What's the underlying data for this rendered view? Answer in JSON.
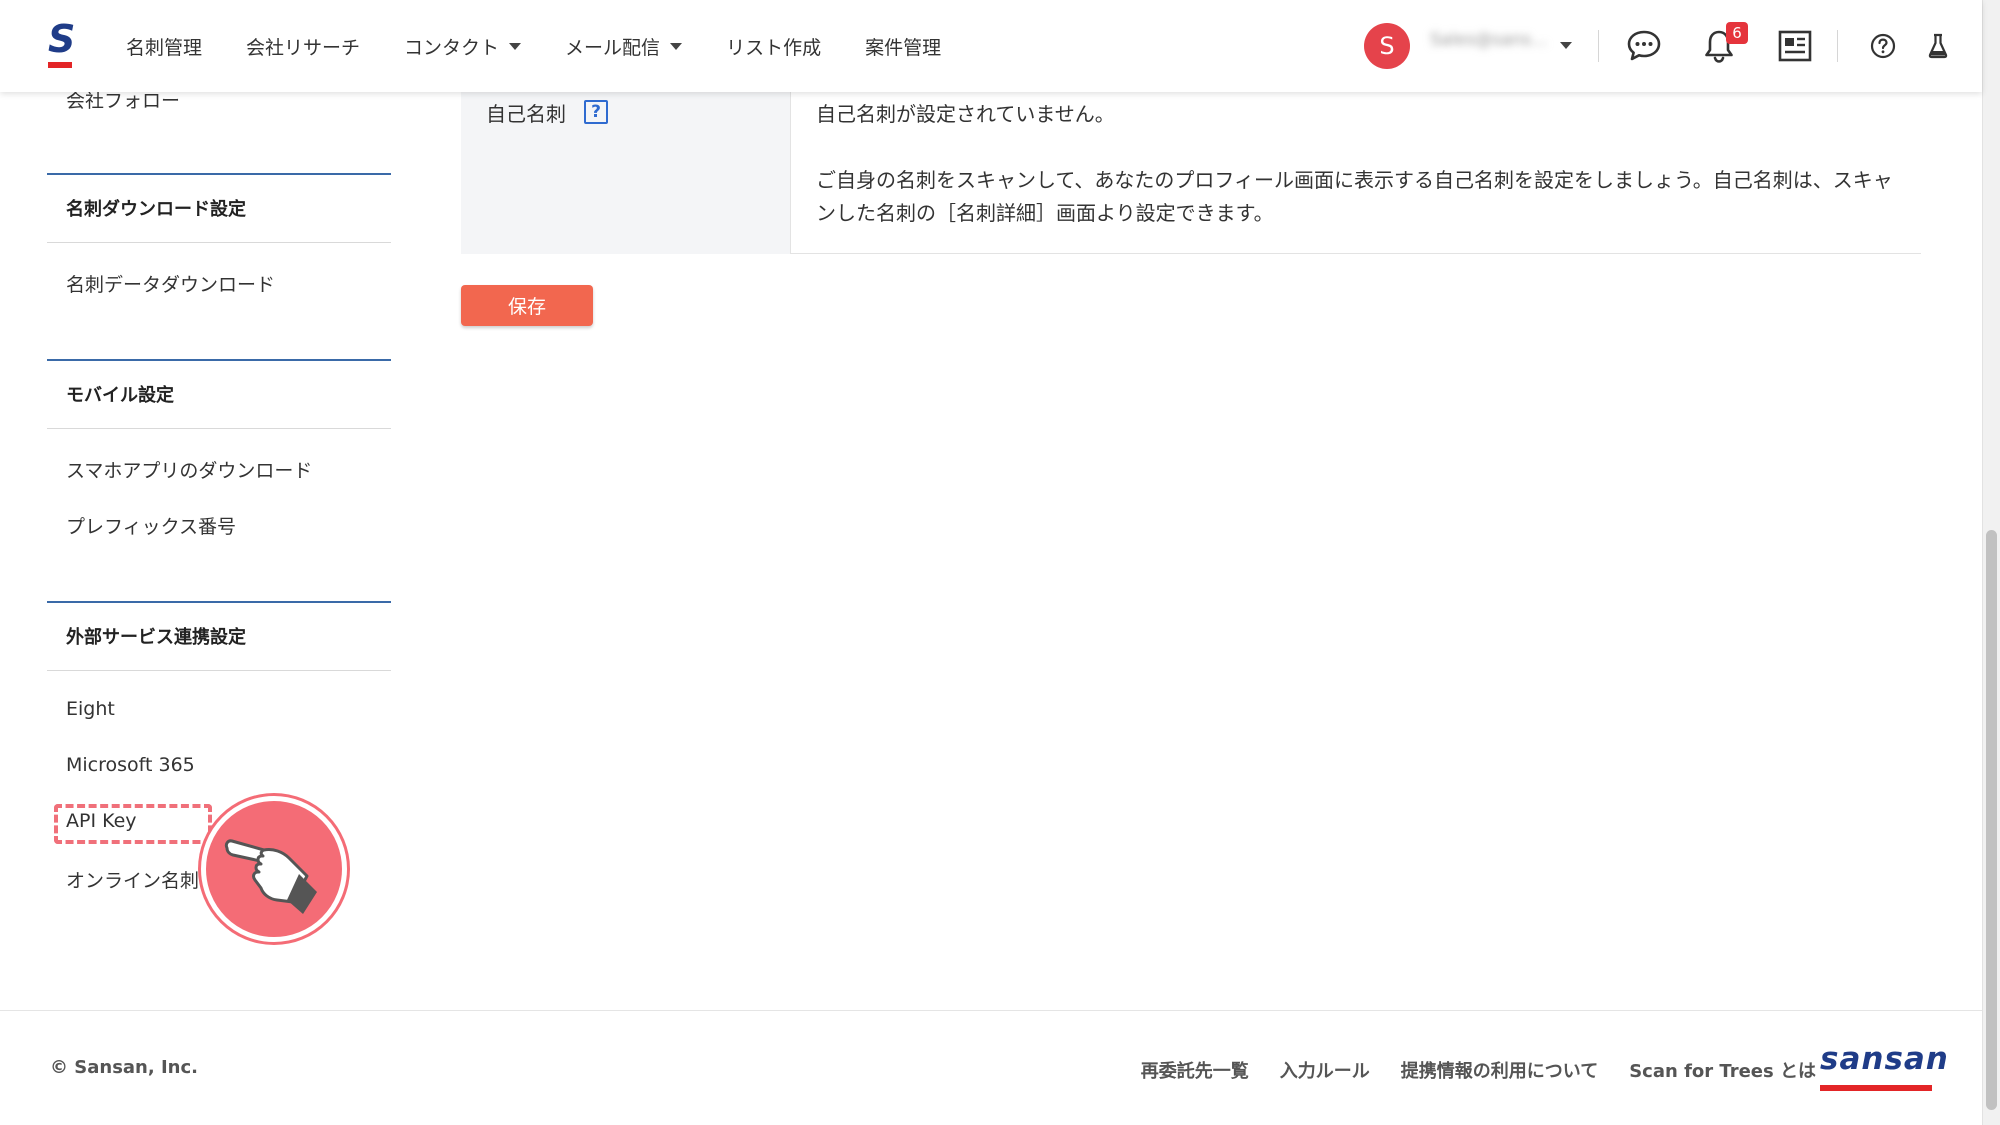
{
  "header": {
    "nav": [
      {
        "label": "名刺管理",
        "dropdown": false
      },
      {
        "label": "会社リサーチ",
        "dropdown": false
      },
      {
        "label": "コンタクト",
        "dropdown": true
      },
      {
        "label": "メール配信",
        "dropdown": true
      },
      {
        "label": "リスト作成",
        "dropdown": false
      },
      {
        "label": "案件管理",
        "dropdown": false
      }
    ],
    "avatar_initial": "S",
    "user_name": "Sales@sans...",
    "notification_count": "6"
  },
  "sidebar": {
    "cut_link": "会社フォロー",
    "section1_title": "名刺ダウンロード設定",
    "section1_items": [
      "名刺データダウンロード"
    ],
    "section2_title": "モバイル設定",
    "section2_items": [
      "スマホアプリのダウンロード",
      "プレフィックス番号"
    ],
    "section3_title": "外部サービス連携設定",
    "section3_items": [
      "Eight",
      "Microsoft 365",
      "API Key",
      "オンライン名刺設定"
    ]
  },
  "main": {
    "field_label": "自己名刺",
    "help_glyph": "?",
    "message_line1": "自己名刺が設定されていません。",
    "message_line2": "ご自身の名刺をスキャンして、あなたのプロフィール画面に表示する自己名刺を設定をしましょう。自己名刺は、スキャンした名刺の［名刺詳細］画面より設定できます。",
    "save_label": "保存"
  },
  "footer": {
    "copyright": "© Sansan, Inc.",
    "links": [
      "再委託先一覧",
      "入力ルール",
      "提携情報の利用について",
      "Scan for Trees とは"
    ],
    "brand": "sansan"
  },
  "logo_letter": "S",
  "colors": {
    "brand_blue": "#1f3c88",
    "brand_red": "#e32527",
    "save_button": "#f2674f",
    "avatar": "#e5434b",
    "annotation": "#f46c76"
  }
}
